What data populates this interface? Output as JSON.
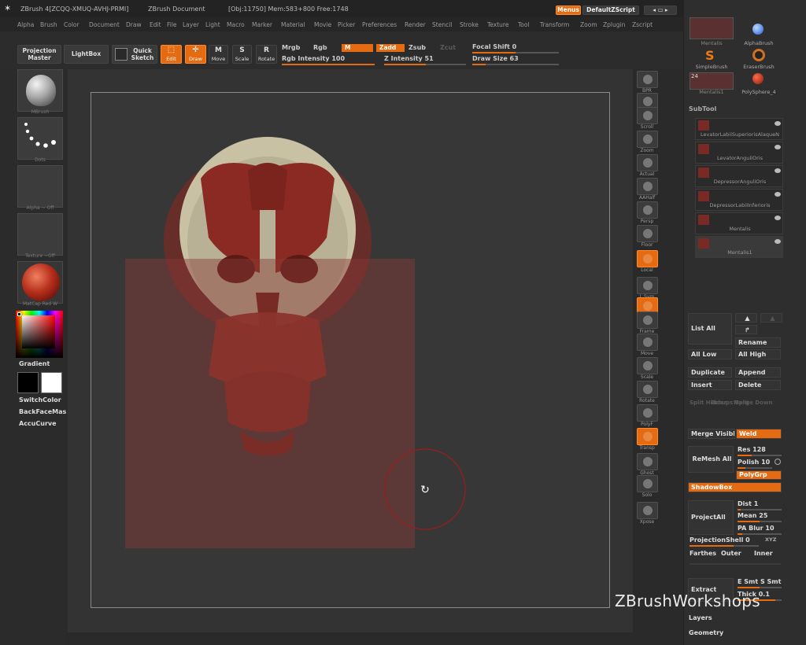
{
  "titlebar": {
    "app": "ZBrush 4[ZCQQ-XMUQ-AVHJ-PRMI]",
    "doc": "ZBrush Document",
    "stats": "[Obj:11750] Mem:583+800 Free:1748",
    "menus_btn": "Menus",
    "script_btn": "DefaultZScript"
  },
  "menu": [
    "Alpha",
    "Brush",
    "Color",
    "Document",
    "Draw",
    "Edit",
    "File",
    "Layer",
    "Light",
    "Macro",
    "Marker",
    "Material",
    "Movie",
    "Picker",
    "Preferences",
    "Render",
    "Stencil",
    "Stroke",
    "Texture",
    "Tool",
    "Transform",
    "Zoom",
    "Zplugin",
    "Zscript"
  ],
  "toolbar": {
    "projection_master": "Projection Master",
    "lightbox": "LightBox",
    "quick_sketch": "Quick Sketch",
    "edit": "Edit",
    "draw": "Draw",
    "move": "Move",
    "scale": "Scale",
    "rotate": "Rotate",
    "mrgb": "Mrgb",
    "rgb": "Rgb",
    "m": "M",
    "zadd": "Zadd",
    "zsub": "Zsub",
    "zcut": "Zcut",
    "focal_shift": "Focal Shift 0",
    "focal_shift_value": 0,
    "draw_size": "Draw Size 63",
    "draw_size_value": 63,
    "rgb_intensity": "Rgb Intensity 100",
    "rgb_intensity_value": 100,
    "z_intensity": "Z Intensity 51",
    "z_intensity_value": 51
  },
  "left": {
    "material": "MBrush",
    "stroke": "Dots",
    "alpha": "Alpha ~ Off",
    "texture": "Texture ~Off",
    "matcap": "MatCap Red W",
    "gradient": "Gradient",
    "switchcolor": "SwitchColor",
    "backface": "BackFaceMas",
    "accucurve": "AccuCurve",
    "colors": {
      "primary": "#000000",
      "secondary": "#ffffff"
    }
  },
  "righttools": [
    {
      "label": "BPR",
      "orange": false
    },
    {
      "label": "SPix",
      "orange": false
    },
    {
      "label": "Scroll",
      "orange": false
    },
    {
      "label": "Zoom",
      "orange": false
    },
    {
      "label": "Actual",
      "orange": false
    },
    {
      "label": "AAHalf",
      "orange": false
    },
    {
      "label": "Persp",
      "orange": false
    },
    {
      "label": "Floor",
      "orange": false
    },
    {
      "label": "Local",
      "orange": true
    },
    {
      "label": "L.Sym",
      "orange": false
    },
    {
      "label": "XYZ",
      "orange": true
    },
    {
      "label": "Frame",
      "orange": false
    },
    {
      "label": "Move",
      "orange": false
    },
    {
      "label": "Scale",
      "orange": false
    },
    {
      "label": "Rotate",
      "orange": false
    },
    {
      "label": "PolyF",
      "orange": false
    },
    {
      "label": "Transp",
      "orange": true
    },
    {
      "label": "Ghost",
      "orange": false
    },
    {
      "label": "Solo",
      "orange": false
    },
    {
      "label": "Xpose",
      "orange": false
    }
  ],
  "panel": {
    "tools": [
      {
        "label": "Mentalis"
      },
      {
        "label": "AlphaBrush"
      },
      {
        "label": "SimpleBrush"
      },
      {
        "label": "EraserBrush"
      },
      {
        "label": "Mentalis1"
      },
      {
        "label": "PolySphere_4"
      }
    ],
    "tool_count": "24",
    "subtool_header": "SubTool",
    "subtools": [
      {
        "name": "LevatorLabiiSuperiorisAlaqueN"
      },
      {
        "name": "LevatorAnguliOris"
      },
      {
        "name": "DepressorAnguliOris"
      },
      {
        "name": "DepressorLabiiInferioris"
      },
      {
        "name": "Mentalis"
      },
      {
        "name": "Mentalis1"
      }
    ],
    "list_all": "List All",
    "rename": "Rename",
    "all_low": "All Low",
    "all_high": "All High",
    "duplicate": "Duplicate",
    "append": "Append",
    "insert": "Insert",
    "delete": "Delete",
    "split_hidden": "Split Hidden",
    "groups_split": "Groups Split",
    "merge_down": "Merge Down",
    "merge_visible": "Merge Visibl",
    "weld": "Weld",
    "remesh_all": "ReMesh All",
    "res": "Res 128",
    "polish": "Polish 10",
    "polygrp": "PolyGrp",
    "shadowbox": "ShadowBox",
    "project_all": "ProjectAll",
    "dist": "Dist 1",
    "mean": "Mean 25",
    "pa_blur": "PA Blur 10",
    "projection_shell": "ProjectionShell 0",
    "xyz": "XYZ",
    "farthest": "Farthes",
    "outer": "Outer",
    "inner": "Inner",
    "extract": "Extract",
    "e_smt": "E Smt",
    "s_smt": "S Smt",
    "thick": "Thick 0.1",
    "layers": "Layers",
    "geometry": "Geometry"
  },
  "watermark": "ZBrushWorkshops"
}
